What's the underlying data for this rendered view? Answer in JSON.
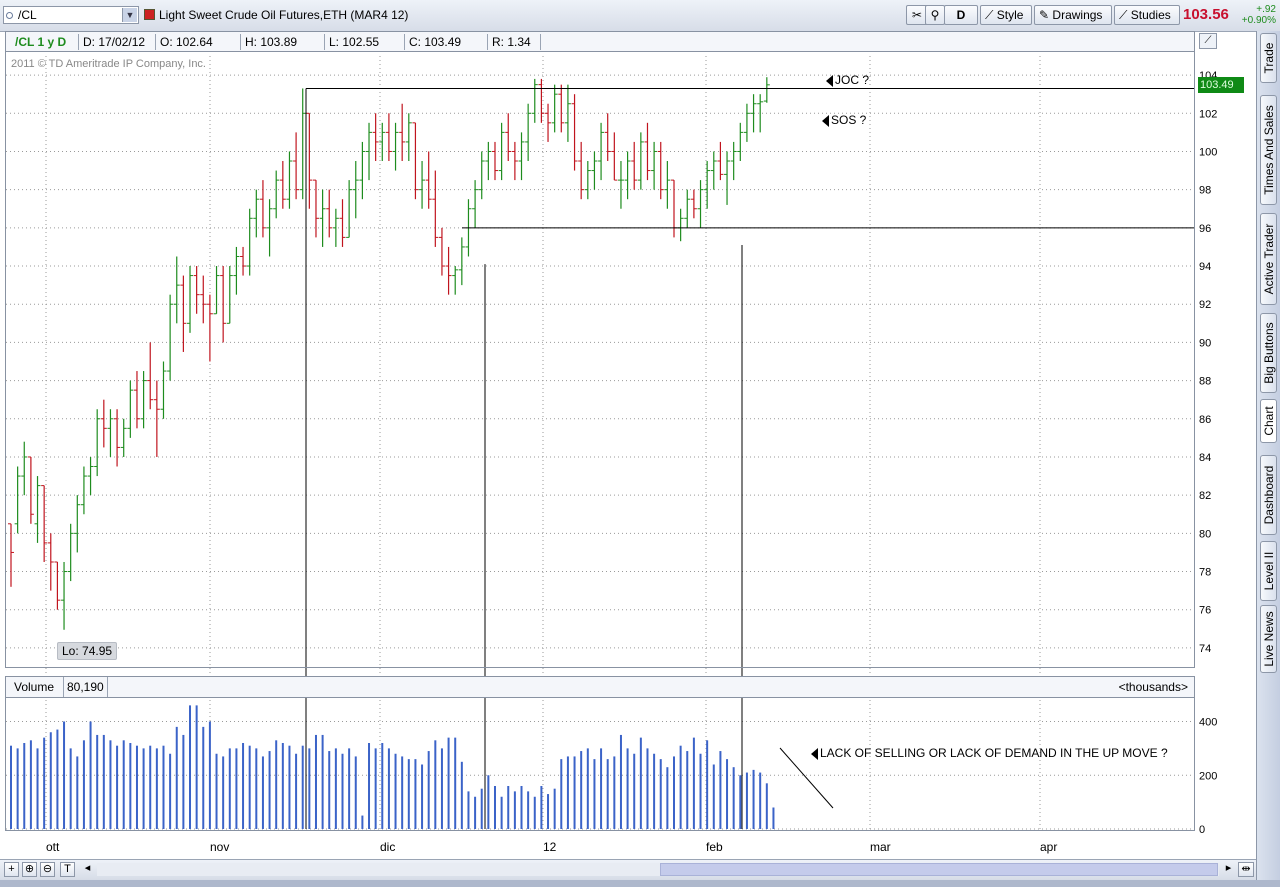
{
  "toolbar": {
    "symbol": "/CL",
    "title": "Light Sweet Crude Oil Futures,ETH (MAR4 12)",
    "aggregation": "D",
    "style_label": "Style",
    "drawings_label": "Drawings",
    "studies_label": "Studies",
    "last_price": "103.56",
    "change": "+.92",
    "change_pct": "+0.90%"
  },
  "ohlc": {
    "symbol_period": "/CL 1 y D",
    "date": "D: 17/02/12",
    "open": "O: 102.64",
    "high": "H: 103.89",
    "low": "L: 102.55",
    "close": "C: 103.49",
    "range": "R: 1.34"
  },
  "copyright": "2011 © TD Ameritrade IP Company, Inc.",
  "annotations": {
    "joc": "JOC ?",
    "sos": "SOS ?",
    "volume_note": "LACK OF SELLING OR LACK OF DEMAND IN THE UP MOVE ?",
    "low_label": "Lo: 74.95",
    "price_tag": "103.49"
  },
  "volume_header": {
    "label": "Volume",
    "value": "80,190",
    "units": "<thousands>"
  },
  "side_tabs": [
    "Trade",
    "Times And Sales",
    "Active Trader",
    "Big Buttons",
    "Chart",
    "Dashboard",
    "Level II",
    "Live News"
  ],
  "colors": {
    "up": "#1e8c1e",
    "down": "#c0141e",
    "volume": "#3b63c8",
    "accent_price": "#c8102e"
  },
  "chart_data": {
    "type": "bar",
    "x_tick_labels": [
      "ott",
      "nov",
      "dic",
      "12",
      "feb",
      "mar",
      "apr"
    ],
    "y_ticks": [
      74,
      76,
      78,
      80,
      82,
      84,
      86,
      88,
      90,
      92,
      94,
      96,
      98,
      100,
      102,
      104
    ],
    "ylim": [
      73,
      105
    ],
    "volume_ticks": [
      0,
      200,
      400
    ],
    "volume_ylim": [
      0,
      480
    ],
    "bars": [
      [
        80.5,
        77.2,
        80.5,
        79.0,
        0
      ],
      [
        83.5,
        80.0,
        80.5,
        83.0,
        1
      ],
      [
        84.8,
        82.0,
        83.0,
        84.0,
        1
      ],
      [
        84.0,
        80.5,
        84.0,
        81.0,
        0
      ],
      [
        83.0,
        79.5,
        80.5,
        82.5,
        1
      ],
      [
        82.5,
        78.5,
        82.5,
        79.5,
        0
      ],
      [
        80.0,
        77.0,
        79.5,
        78.5,
        0
      ],
      [
        78.5,
        76.0,
        78.5,
        76.5,
        0
      ],
      [
        78.5,
        74.95,
        76.5,
        78.0,
        1
      ],
      [
        80.5,
        77.5,
        78.0,
        80.0,
        1
      ],
      [
        82.0,
        79.0,
        80.0,
        81.5,
        1
      ],
      [
        83.5,
        81.0,
        81.5,
        83.0,
        1
      ],
      [
        84.0,
        82.0,
        83.0,
        83.5,
        1
      ],
      [
        86.5,
        83.0,
        83.5,
        86.0,
        1
      ],
      [
        87.0,
        84.5,
        86.0,
        85.5,
        0
      ],
      [
        86.5,
        84.0,
        85.5,
        86.0,
        1
      ],
      [
        86.5,
        83.5,
        86.0,
        84.5,
        0
      ],
      [
        86.0,
        84.0,
        84.5,
        85.5,
        1
      ],
      [
        88.0,
        85.0,
        85.5,
        87.5,
        1
      ],
      [
        88.5,
        85.5,
        87.5,
        86.0,
        0
      ],
      [
        88.5,
        85.5,
        86.0,
        88.0,
        1
      ],
      [
        90.0,
        86.5,
        88.0,
        87.0,
        0
      ],
      [
        88.0,
        84.0,
        87.0,
        86.5,
        0
      ],
      [
        89.0,
        86.0,
        86.5,
        88.5,
        1
      ],
      [
        92.5,
        88.0,
        88.5,
        92.0,
        1
      ],
      [
        94.5,
        91.0,
        92.0,
        93.0,
        1
      ],
      [
        93.5,
        89.5,
        93.0,
        91.0,
        0
      ],
      [
        94.0,
        90.5,
        91.0,
        93.5,
        1
      ],
      [
        94.0,
        91.5,
        93.5,
        92.5,
        0
      ],
      [
        93.5,
        91.0,
        92.5,
        92.0,
        0
      ],
      [
        92.5,
        89.0,
        92.0,
        91.5,
        0
      ],
      [
        94.0,
        91.5,
        91.5,
        93.5,
        1
      ],
      [
        94.0,
        90.0,
        93.5,
        91.0,
        0
      ],
      [
        94.0,
        91.0,
        91.0,
        93.5,
        1
      ],
      [
        95.0,
        92.5,
        93.5,
        94.5,
        1
      ],
      [
        95.0,
        93.5,
        94.5,
        94.0,
        0
      ],
      [
        97.0,
        93.5,
        94.0,
        96.5,
        1
      ],
      [
        98.0,
        95.5,
        96.5,
        97.5,
        1
      ],
      [
        98.5,
        95.5,
        97.5,
        96.0,
        0
      ],
      [
        97.5,
        94.5,
        96.0,
        97.0,
        1
      ],
      [
        99.0,
        96.5,
        97.0,
        98.5,
        1
      ],
      [
        99.5,
        97.0,
        98.5,
        97.5,
        0
      ],
      [
        100.0,
        97.0,
        97.5,
        99.5,
        1
      ],
      [
        101.0,
        97.5,
        99.5,
        98.0,
        0
      ],
      [
        103.3,
        97.5,
        98.0,
        102.0,
        1
      ],
      [
        102.0,
        97.0,
        102.0,
        98.5,
        0
      ],
      [
        98.5,
        95.5,
        98.5,
        96.5,
        0
      ],
      [
        98.0,
        95.0,
        96.5,
        97.0,
        1
      ],
      [
        98.0,
        95.5,
        97.0,
        96.0,
        0
      ],
      [
        97.0,
        95.0,
        96.0,
        96.5,
        1
      ],
      [
        97.5,
        95.0,
        96.5,
        95.5,
        0
      ],
      [
        98.5,
        95.5,
        95.5,
        98.0,
        1
      ],
      [
        99.5,
        96.5,
        98.0,
        98.5,
        1
      ],
      [
        100.5,
        97.5,
        98.5,
        100.0,
        1
      ],
      [
        101.5,
        98.5,
        100.0,
        101.0,
        1
      ],
      [
        102.0,
        99.5,
        101.0,
        100.5,
        0
      ],
      [
        101.5,
        99.5,
        100.5,
        101.0,
        1
      ],
      [
        102.0,
        99.5,
        101.0,
        100.0,
        0
      ],
      [
        101.5,
        99.0,
        100.0,
        101.0,
        1
      ],
      [
        102.5,
        99.5,
        101.0,
        100.5,
        0
      ],
      [
        102.0,
        99.5,
        100.5,
        101.5,
        1
      ],
      [
        101.5,
        97.5,
        101.5,
        98.0,
        0
      ],
      [
        99.5,
        97.0,
        98.0,
        98.5,
        1
      ],
      [
        100.0,
        97.0,
        98.5,
        97.5,
        0
      ],
      [
        99.0,
        95.0,
        97.5,
        95.5,
        0
      ],
      [
        96.0,
        93.5,
        95.5,
        94.0,
        0
      ],
      [
        95.0,
        92.5,
        94.0,
        93.5,
        0
      ],
      [
        94.0,
        92.5,
        93.5,
        93.8,
        1
      ],
      [
        95.5,
        93.0,
        93.8,
        95.0,
        1
      ],
      [
        97.5,
        94.5,
        95.0,
        97.0,
        1
      ],
      [
        98.5,
        96.0,
        97.0,
        98.0,
        1
      ],
      [
        100.0,
        97.5,
        98.0,
        99.5,
        1
      ],
      [
        100.5,
        98.5,
        99.5,
        100.0,
        1
      ],
      [
        100.5,
        98.5,
        100.0,
        99.0,
        0
      ],
      [
        101.5,
        98.5,
        99.0,
        101.0,
        1
      ],
      [
        102.0,
        99.5,
        101.0,
        100.0,
        0
      ],
      [
        100.5,
        98.5,
        100.0,
        99.5,
        0
      ],
      [
        101.0,
        98.5,
        99.5,
        100.5,
        1
      ],
      [
        102.5,
        99.5,
        100.5,
        102.0,
        1
      ],
      [
        103.8,
        101.5,
        102.0,
        103.5,
        1
      ],
      [
        103.8,
        101.5,
        103.5,
        102.0,
        0
      ],
      [
        102.5,
        100.5,
        102.0,
        101.5,
        0
      ],
      [
        103.5,
        101.0,
        101.5,
        103.0,
        1
      ],
      [
        103.5,
        101.0,
        103.0,
        101.5,
        0
      ],
      [
        103.5,
        100.5,
        101.5,
        102.5,
        1
      ],
      [
        103.0,
        99.0,
        102.5,
        99.5,
        0
      ],
      [
        100.5,
        97.5,
        99.5,
        98.0,
        0
      ],
      [
        99.5,
        97.5,
        98.0,
        99.0,
        1
      ],
      [
        100.0,
        98.0,
        99.0,
        99.5,
        1
      ],
      [
        101.5,
        98.5,
        99.5,
        101.0,
        1
      ],
      [
        102.0,
        99.5,
        101.0,
        100.0,
        0
      ],
      [
        101.0,
        98.5,
        100.0,
        98.5,
        0
      ],
      [
        99.5,
        97.0,
        98.5,
        98.5,
        1
      ],
      [
        100.0,
        97.5,
        98.5,
        99.5,
        1
      ],
      [
        100.5,
        98.0,
        99.5,
        98.5,
        0
      ],
      [
        101.0,
        98.0,
        98.5,
        100.5,
        1
      ],
      [
        101.5,
        98.5,
        100.5,
        99.0,
        0
      ],
      [
        100.5,
        98.0,
        99.0,
        100.0,
        1
      ],
      [
        100.5,
        97.5,
        100.0,
        98.0,
        0
      ],
      [
        99.5,
        97.0,
        98.0,
        98.5,
        1
      ],
      [
        98.5,
        95.5,
        98.5,
        96.0,
        0
      ],
      [
        97.0,
        95.3,
        96.0,
        96.5,
        1
      ],
      [
        98.0,
        96.0,
        96.5,
        97.5,
        1
      ],
      [
        98.0,
        96.5,
        97.5,
        97.0,
        0
      ],
      [
        98.5,
        96.0,
        97.0,
        98.0,
        1
      ],
      [
        99.5,
        97.0,
        98.0,
        99.0,
        1
      ],
      [
        100.0,
        98.0,
        99.0,
        99.5,
        1
      ],
      [
        100.5,
        98.5,
        99.5,
        98.8,
        0
      ],
      [
        100.0,
        97.2,
        98.8,
        99.5,
        1
      ],
      [
        100.5,
        98.5,
        99.5,
        100.0,
        1
      ],
      [
        101.5,
        99.5,
        100.0,
        101.0,
        1
      ],
      [
        102.5,
        100.5,
        101.0,
        102.0,
        1
      ],
      [
        103.0,
        101.0,
        102.0,
        102.5,
        1
      ],
      [
        103.0,
        101.0,
        102.5,
        102.6,
        1
      ],
      [
        103.89,
        102.55,
        102.64,
        103.49,
        1
      ]
    ],
    "volume": [
      310,
      300,
      320,
      330,
      300,
      340,
      360,
      370,
      400,
      300,
      270,
      330,
      400,
      350,
      350,
      330,
      310,
      330,
      320,
      310,
      300,
      310,
      300,
      310,
      280,
      380,
      350,
      460,
      460,
      380,
      400,
      280,
      270,
      300,
      300,
      320,
      310,
      300,
      270,
      290,
      330,
      320,
      310,
      280,
      310,
      300,
      350,
      350,
      290,
      300,
      280,
      300,
      270,
      50,
      320,
      300,
      320,
      300,
      280,
      270,
      260,
      260,
      240,
      290,
      330,
      300,
      340,
      340,
      250,
      140,
      120,
      150,
      200,
      160,
      120,
      160,
      140,
      160,
      140,
      120,
      160,
      130,
      150,
      260,
      270,
      270,
      290,
      300,
      260,
      300,
      260,
      270,
      350,
      300,
      280,
      340,
      300,
      280,
      260,
      230,
      270,
      310,
      290,
      340,
      280,
      330,
      240,
      290,
      260,
      230,
      200,
      210,
      220,
      210,
      170,
      80
    ]
  }
}
